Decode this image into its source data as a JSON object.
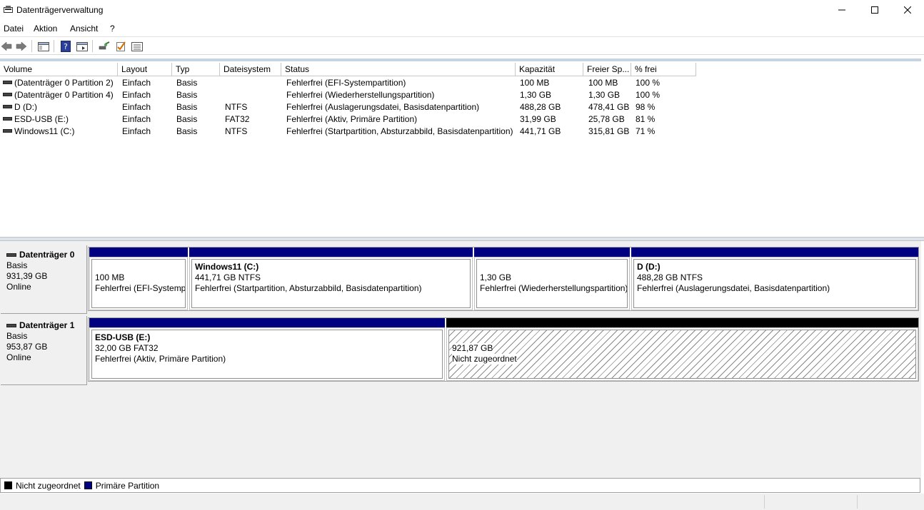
{
  "window": {
    "title": "Datenträgerverwaltung"
  },
  "menu": [
    "Datei",
    "Aktion",
    "Ansicht",
    "?"
  ],
  "toolbar": {
    "icons": [
      "back-arrow-icon",
      "forward-arrow-icon",
      "console-tree-icon",
      "help-icon",
      "properties-view-icon",
      "connect-icon",
      "check-icon",
      "list-view-icon"
    ]
  },
  "columns": [
    "Volume",
    "Layout",
    "Typ",
    "Dateisystem",
    "Status",
    "Kapazität",
    "Freier Sp...",
    "% frei"
  ],
  "volumes": [
    {
      "volume": "(Datenträger 0 Partition 2)",
      "layout": "Einfach",
      "typ": "Basis",
      "fs": "",
      "status": "Fehlerfrei (EFI-Systempartition)",
      "capacity": "100 MB",
      "free": "100 MB",
      "pct": "100 %"
    },
    {
      "volume": "(Datenträger 0 Partition 4)",
      "layout": "Einfach",
      "typ": "Basis",
      "fs": "",
      "status": "Fehlerfrei (Wiederherstellungspartition)",
      "capacity": "1,30 GB",
      "free": "1,30 GB",
      "pct": "100 %"
    },
    {
      "volume": "D (D:)",
      "layout": "Einfach",
      "typ": "Basis",
      "fs": "NTFS",
      "status": "Fehlerfrei (Auslagerungsdatei, Basisdatenpartition)",
      "capacity": "488,28 GB",
      "free": "478,41 GB",
      "pct": "98 %"
    },
    {
      "volume": "ESD-USB (E:)",
      "layout": "Einfach",
      "typ": "Basis",
      "fs": "FAT32",
      "status": "Fehlerfrei (Aktiv, Primäre Partition)",
      "capacity": "31,99 GB",
      "free": "25,78 GB",
      "pct": "81 %"
    },
    {
      "volume": "Windows11 (C:)",
      "layout": "Einfach",
      "typ": "Basis",
      "fs": "NTFS",
      "status": "Fehlerfrei (Startpartition, Absturzabbild, Basisdatenpartition)",
      "capacity": "441,71 GB",
      "free": "315,81 GB",
      "pct": "71 %"
    }
  ],
  "disks": [
    {
      "name": "Datenträger 0",
      "type": "Basis",
      "size": "931,39 GB",
      "state": "Online",
      "partitions": [
        {
          "title": "",
          "size": "100 MB",
          "status": "Fehlerfrei (EFI-Systempartition)",
          "kind": "primary"
        },
        {
          "title": "Windows11  (C:)",
          "size": "441,71 GB NTFS",
          "status": "Fehlerfrei (Startpartition, Absturzabbild, Basisdatenpartition)",
          "kind": "primary"
        },
        {
          "title": "",
          "size": "1,30 GB",
          "status": "Fehlerfrei (Wiederherstellungspartition)",
          "kind": "primary"
        },
        {
          "title": "D  (D:)",
          "size": "488,28 GB NTFS",
          "status": "Fehlerfrei (Auslagerungsdatei, Basisdatenpartition)",
          "kind": "primary"
        }
      ]
    },
    {
      "name": "Datenträger 1",
      "type": "Basis",
      "size": "953,87 GB",
      "state": "Online",
      "partitions": [
        {
          "title": "ESD-USB  (E:)",
          "size": "32,00 GB FAT32",
          "status": "Fehlerfrei (Aktiv, Primäre Partition)",
          "kind": "primary"
        },
        {
          "title": "",
          "size": "921,87 GB",
          "status": "Nicht zugeordnet",
          "kind": "unallocated"
        }
      ]
    }
  ],
  "legend": [
    {
      "label": "Nicht zugeordnet",
      "color": "#000000"
    },
    {
      "label": "Primäre Partition",
      "color": "#000080"
    }
  ],
  "colors": {
    "primary": "#000080",
    "unallocated": "#000000"
  }
}
